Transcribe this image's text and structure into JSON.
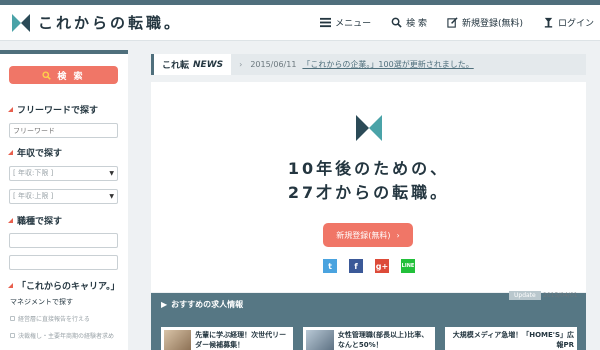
{
  "header": {
    "logo_text": "これからの転職。",
    "nav": [
      {
        "label": "メニュー",
        "icon": "menu-icon"
      },
      {
        "label": "検 索",
        "icon": "search-icon"
      },
      {
        "label": "新規登録(無料)",
        "icon": "edit-icon"
      },
      {
        "label": "ログイン",
        "icon": "login-icon"
      }
    ]
  },
  "sidebar": {
    "search_button": "検 索",
    "freeword_title": "フリーワードで探す",
    "freeword_placeholder": "フリーワード",
    "salary_title": "年収で探す",
    "salary_min": "[ 年収:下限 ]",
    "salary_max": "[ 年収:上限 ]",
    "job_title": "職種で探す",
    "career_title": "「これからのキャリア。」",
    "management": "マネジメントで探す",
    "sub_items": [
      "経営層に直接報告を行える",
      "決裁権し・主要年商期の経験者求め"
    ]
  },
  "news": {
    "tag_prefix": "これ転",
    "tag_word": "NEWS",
    "date": "2015/06/11",
    "link": "「これからの企業。」100選が更新されました。"
  },
  "hero": {
    "line1": "10年後のための、",
    "line2": "27才からの転職。",
    "cta": "新規登録(無料)",
    "socials": [
      {
        "icon": "twitter-icon",
        "glyph": "t",
        "color": "#4aa3df"
      },
      {
        "icon": "facebook-icon",
        "glyph": "f",
        "color": "#3b5998"
      },
      {
        "icon": "googleplus-icon",
        "glyph": "g+",
        "color": "#dd4b39"
      },
      {
        "icon": "line-icon",
        "glyph": "LINE",
        "color": "#22c03a"
      }
    ]
  },
  "jobs": {
    "title": "おすすめの求人情報",
    "update_label": "Update",
    "update_date": "2015/04/01",
    "cards": [
      {
        "text": "先輩に学ぶ経理！次世代リーダー候補募集！"
      },
      {
        "text": "女性管理職(部長以上)比率、なんと50%！"
      },
      {
        "text": "大規模メディア急増！「HOME'S」広報PR"
      }
    ]
  },
  "colors": {
    "accent": "#f07667",
    "brand": "#4f6f7c",
    "teal": "#4aa3a8"
  }
}
